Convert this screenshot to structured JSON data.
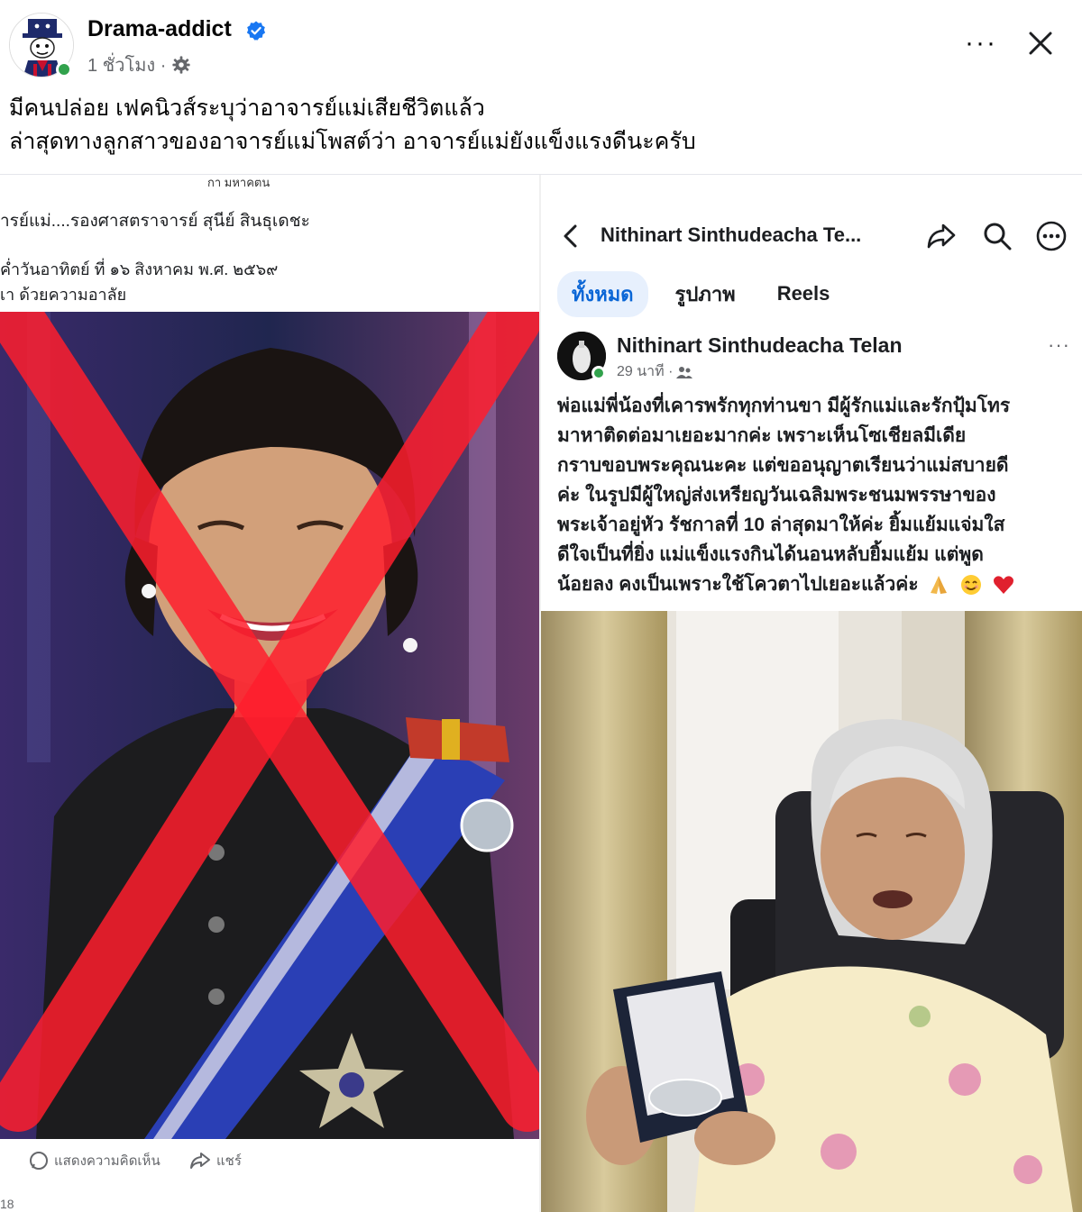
{
  "post": {
    "page_name": "Drama-addict",
    "time": "1 ชั่วโมง ·",
    "lines": [
      "มีคนปล่อย เฟคนิวส์ระบุว่าอาจารย์แม่เสียชีวิตแล้ว",
      "ล่าสุดทางลูกสาวของอาจารย์แม่โพสต์ว่า อาจารย์แม่ยังแข็งแรงดีนะครับ"
    ],
    "more_label": "···",
    "icons": {
      "verified": "verified-badge-icon",
      "privacy": "gear-icon",
      "close": "close-icon"
    }
  },
  "left_screenshot": {
    "top_line": "กา มหาคตน",
    "caption_1": "ารย์แม่....รองศาสตราจารย์ สุนีย์ สินธุเดชะ",
    "caption_2": "ค่ำวันอาทิตย์ ที่ ๑๖ สิงหาคม พ.ศ. ๒๕๖๙",
    "caption_3": "เา  ด้วยความอาลัย",
    "comment_label": "แสดงความคิดเห็น",
    "share_label": "แชร์",
    "footer": "18",
    "cross_color": "#ff1e2d"
  },
  "right_screenshot": {
    "nav_title": "Nithinart Sinthudeacha Te...",
    "tabs": [
      {
        "label": "ทั้งหมด",
        "active": true
      },
      {
        "label": "รูปภาพ",
        "active": false
      },
      {
        "label": "Reels",
        "active": false
      }
    ],
    "author": "Nithinart Sinthudeacha Telan",
    "time": "29 นาที ·",
    "more_label": "···",
    "body_lines": [
      "พ่อแม่พี่น้องที่เคารพรักทุกท่านขา  มีผู้รักแม่และรักปุ้มโทร",
      "มาหาติดต่อมาเยอะมากค่ะ  เพราะเห็นโซเชียลมีเดีย",
      "กราบขอบพระคุณนะคะ  แต่ขออนุญาตเรียนว่าแม่สบายดี",
      "ค่ะ  ในรูปมีผู้ใหญ่ส่งเหรียญวันเฉลิมพระชนมพรรษาของ",
      "พระเจ้าอยู่หัว รัชกาลที่ 10  ล่าสุดมาให้ค่ะ  ยิ้มแย้มแจ่มใส",
      "ดีใจเป็นที่ยิ่ง  แม่แข็งแรงกินได้นอนหลับยิ้มแย้ม  แต่พูด",
      "น้อยลง  คงเป็นเพราะใช้โควตาไปเยอะแล้วค่ะ"
    ],
    "emojis": [
      "pray-emoji",
      "smile-emoji",
      "heart-emoji"
    ],
    "accent_color": "#0a66d6"
  }
}
